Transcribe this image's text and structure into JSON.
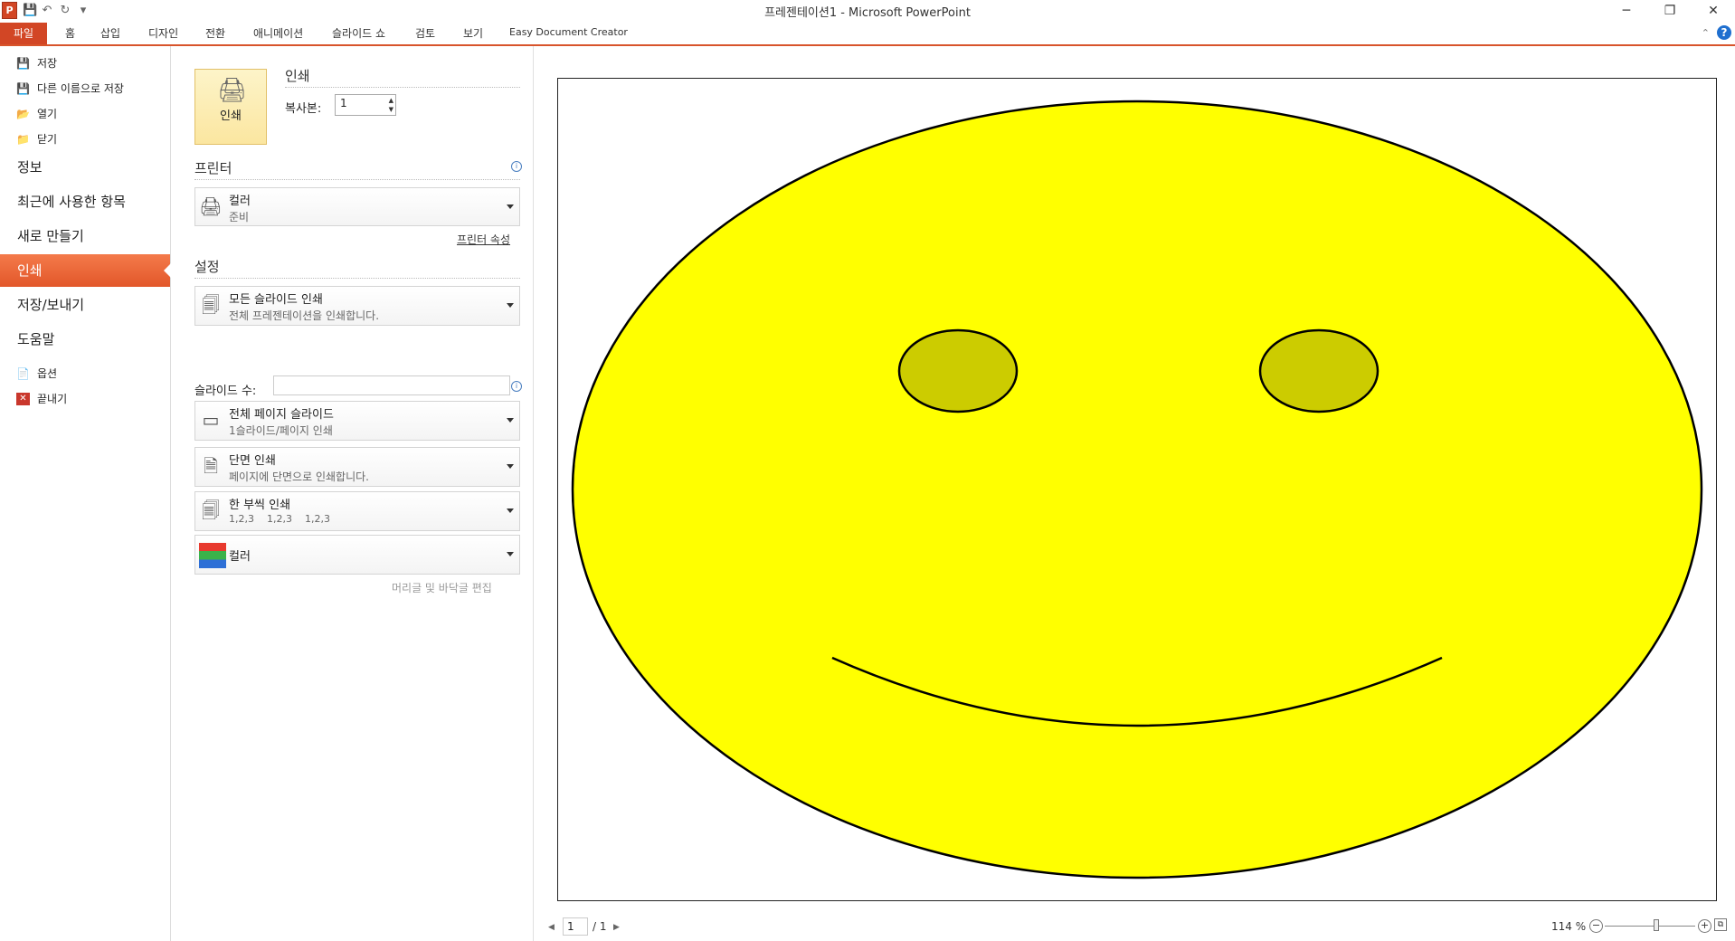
{
  "titlebar": {
    "title": "프레젠테이션1 - Microsoft PowerPoint",
    "app_icon": "P",
    "qat_icons": [
      "save-icon",
      "undo-icon",
      "redo-icon",
      "customize-icon"
    ],
    "window_buttons": [
      "─",
      "❐",
      "✕"
    ]
  },
  "ribbon": {
    "file_tab": "파일",
    "tabs": [
      "홈",
      "삽입",
      "디자인",
      "전환",
      "애니메이션",
      "슬라이드 쇼",
      "검토",
      "보기",
      "Easy Document Creator"
    ],
    "help": "?"
  },
  "nav": {
    "save": "저장",
    "save_as": "다른 이름으로 저장",
    "open": "열기",
    "close": "닫기",
    "info": "정보",
    "recent": "최근에 사용한 항목",
    "new": "새로 만들기",
    "print": "인쇄",
    "save_send": "저장/보내기",
    "help": "도움말",
    "options": "옵션",
    "exit": "끝내기"
  },
  "print_panel": {
    "print_button": "인쇄",
    "print_header": "인쇄",
    "copies_label": "복사본:",
    "copies_value": "1",
    "printer_header": "프린터",
    "printer_name": "컬러",
    "printer_status": "준비",
    "printer_props": "프린터 속성",
    "settings_header": "설정",
    "slides_range": {
      "title": "모든 슬라이드 인쇄",
      "sub": "전체 프레젠테이션을 인쇄합니다."
    },
    "slides_label": "슬라이드 수:",
    "slides_value": "",
    "layout": {
      "title": "전체 페이지 슬라이드",
      "sub": "1슬라이드/페이지 인쇄"
    },
    "sides": {
      "title": "단면 인쇄",
      "sub": "페이지에 단면으로 인쇄합니다."
    },
    "collate": {
      "title": "한 부씩 인쇄",
      "sub": "1,2,3    1,2,3    1,2,3"
    },
    "color": {
      "title": "컬러"
    },
    "header_footer": "머리글 및 바닥글 편집"
  },
  "preview": {
    "page_current": "1",
    "page_total": "/ 1",
    "zoom": "114 %",
    "zoom_fraction": 0.57,
    "colors": {
      "face": "#ffff00",
      "eyes": "#cccc00",
      "outline": "#000000"
    }
  }
}
